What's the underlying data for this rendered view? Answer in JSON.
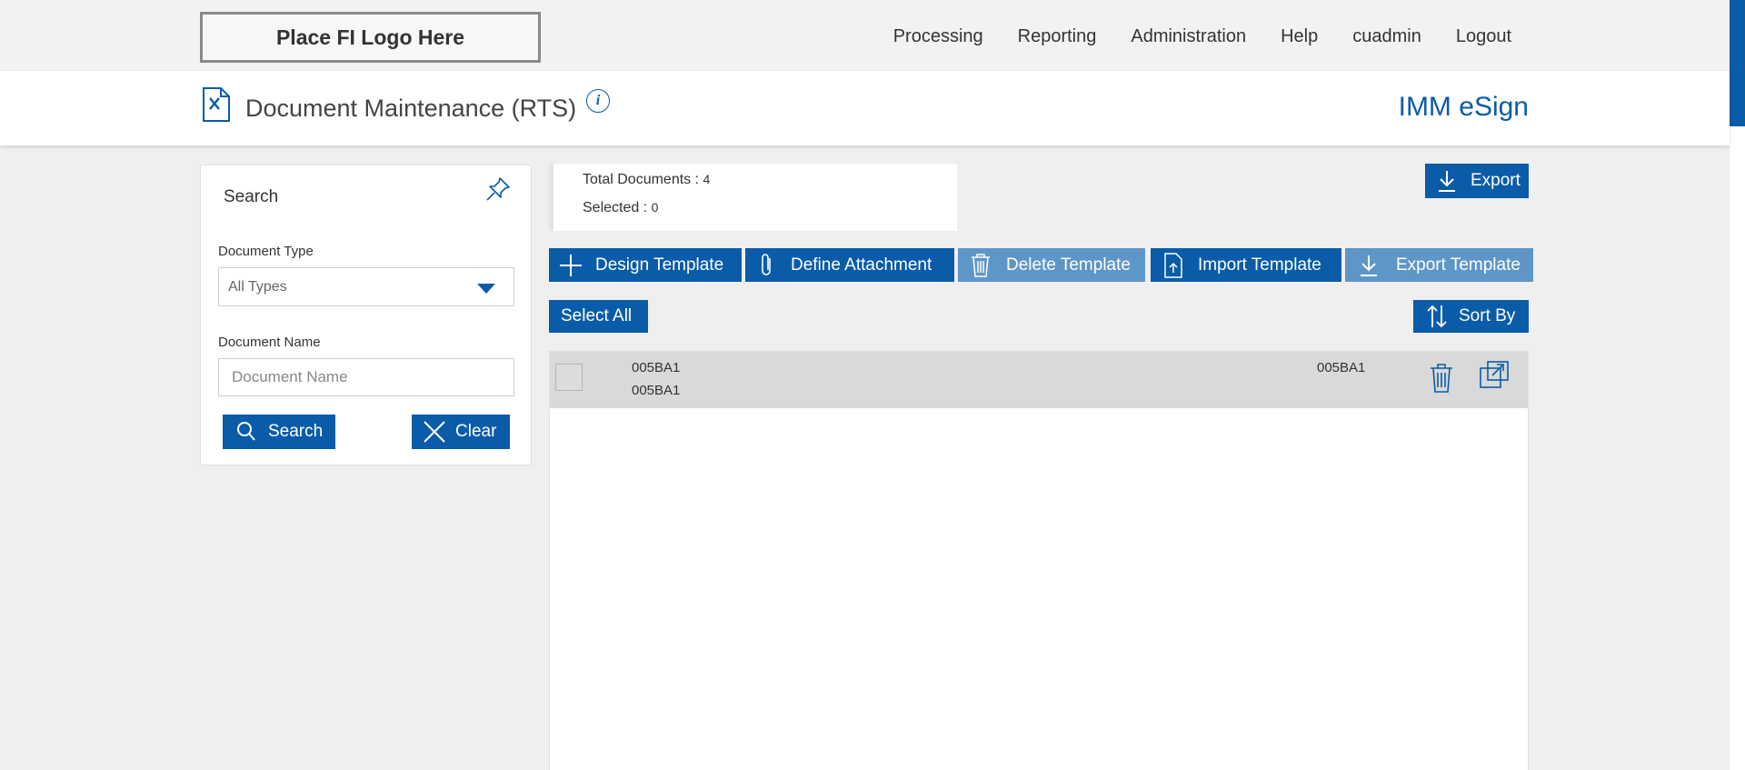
{
  "header": {
    "logo_text": "Place FI Logo Here",
    "nav": [
      "Processing",
      "Reporting",
      "Administration",
      "Help",
      "cuadmin",
      "Logout"
    ]
  },
  "titlebar": {
    "page_title": "Document Maintenance (RTS)",
    "info_glyph": "i",
    "brand": "IMM eSign"
  },
  "search": {
    "title": "Search",
    "doc_type_label": "Document Type",
    "doc_type_value": "All Types",
    "doc_name_label": "Document Name",
    "doc_name_placeholder": "Document Name",
    "search_button": "Search",
    "clear_button": "Clear"
  },
  "counts": {
    "total_label": "Total Documents : ",
    "total_value": "4",
    "selected_label": "Selected : ",
    "selected_value": "0"
  },
  "toolbar": {
    "export": "Export",
    "design_template": "Design Template",
    "define_attachment": "Define Attachment",
    "delete_template": "Delete Template",
    "import_template": "Import Template",
    "export_template": "Export Template",
    "select_all": "Select All",
    "sort_by": "Sort By"
  },
  "documents": [
    {
      "name": "005BA1",
      "subname": "005BA1",
      "code": "005BA1"
    }
  ],
  "colors": {
    "primary": "#0a5ca8",
    "disabled": "#5f96c8",
    "row_bg": "#d9d9d9"
  },
  "icons": [
    "document-tools-icon",
    "info-icon",
    "pin-icon",
    "chevron-down-icon",
    "search-icon",
    "close-icon",
    "download-icon",
    "plus-icon",
    "paperclip-icon",
    "trash-icon",
    "upload-file-icon",
    "sort-icon",
    "open-external-icon"
  ]
}
